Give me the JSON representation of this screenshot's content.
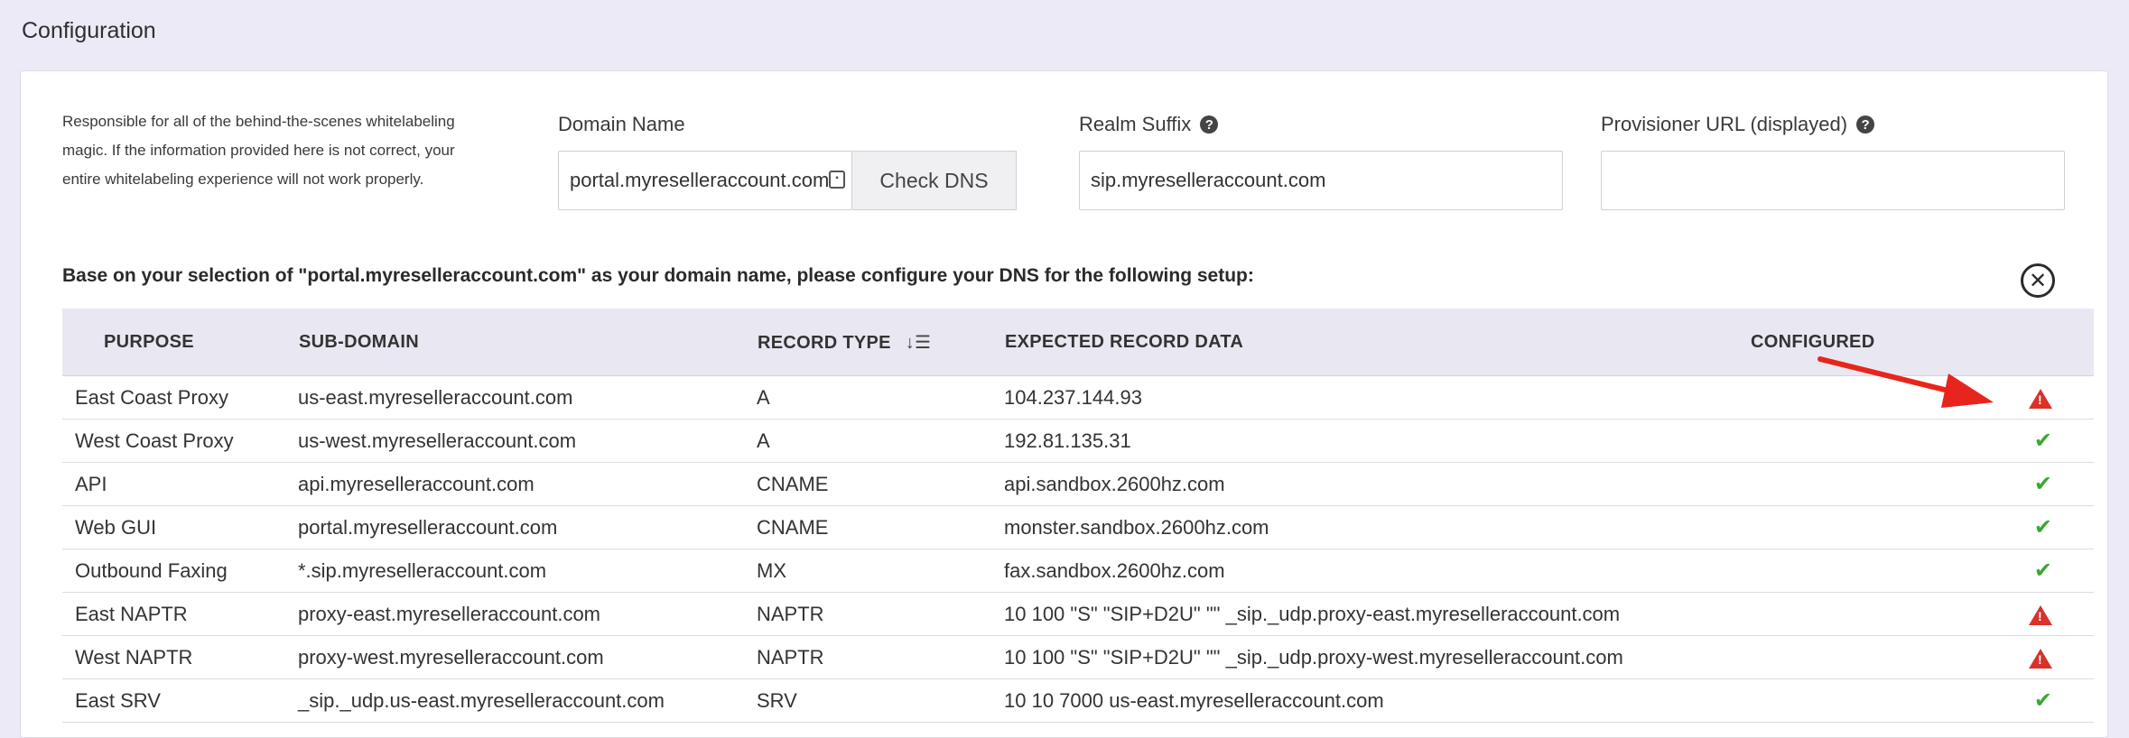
{
  "header": {
    "title": "Configuration"
  },
  "description": "Responsible for all of the behind-the-scenes whitelabeling magic. If the information provided here is not correct, your entire whitelabeling experience will not work properly.",
  "fields": {
    "domain_name": {
      "label": "Domain Name",
      "value": "portal.myreselleraccount.com"
    },
    "check_dns_label": "Check DNS",
    "realm_suffix": {
      "label": "Realm Suffix",
      "value": "sip.myreselleraccount.com"
    },
    "provisioner_url": {
      "label": "Provisioner URL (displayed)",
      "value": ""
    }
  },
  "instruction": "Base on your selection of \"portal.myreselleraccount.com\" as your domain name, please configure your DNS for the following setup:",
  "table": {
    "headers": {
      "purpose": "PURPOSE",
      "subdomain": "SUB-DOMAIN",
      "record_type": "RECORD TYPE",
      "expected": "EXPECTED RECORD DATA",
      "configured": "CONFIGURED"
    },
    "rows": [
      {
        "purpose": "East Coast Proxy",
        "subdomain": "us-east.myreselleraccount.com",
        "type": "A",
        "data": "104.237.144.93",
        "status": "warning"
      },
      {
        "purpose": "West Coast Proxy",
        "subdomain": "us-west.myreselleraccount.com",
        "type": "A",
        "data": "192.81.135.31",
        "status": "ok"
      },
      {
        "purpose": "API",
        "subdomain": "api.myreselleraccount.com",
        "type": "CNAME",
        "data": "api.sandbox.2600hz.com",
        "status": "ok"
      },
      {
        "purpose": "Web GUI",
        "subdomain": "portal.myreselleraccount.com",
        "type": "CNAME",
        "data": "monster.sandbox.2600hz.com",
        "status": "ok"
      },
      {
        "purpose": "Outbound Faxing",
        "subdomain": "*.sip.myreselleraccount.com",
        "type": "MX",
        "data": "fax.sandbox.2600hz.com",
        "status": "ok"
      },
      {
        "purpose": "East NAPTR",
        "subdomain": "proxy-east.myreselleraccount.com",
        "type": "NAPTR",
        "data": "10 100 \"S\" \"SIP+D2U\" \"\" _sip._udp.proxy-east.myreselleraccount.com",
        "status": "warning"
      },
      {
        "purpose": "West NAPTR",
        "subdomain": "proxy-west.myreselleraccount.com",
        "type": "NAPTR",
        "data": "10 100 \"S\" \"SIP+D2U\" \"\" _sip._udp.proxy-west.myreselleraccount.com",
        "status": "warning"
      },
      {
        "purpose": "East SRV",
        "subdomain": "_sip._udp.us-east.myreselleraccount.com",
        "type": "SRV",
        "data": "10 10 7000 us-east.myreselleraccount.com",
        "status": "ok"
      }
    ]
  },
  "colors": {
    "ok": "#3aa832",
    "warning": "#d8322a",
    "arrow": "#e8251c"
  }
}
